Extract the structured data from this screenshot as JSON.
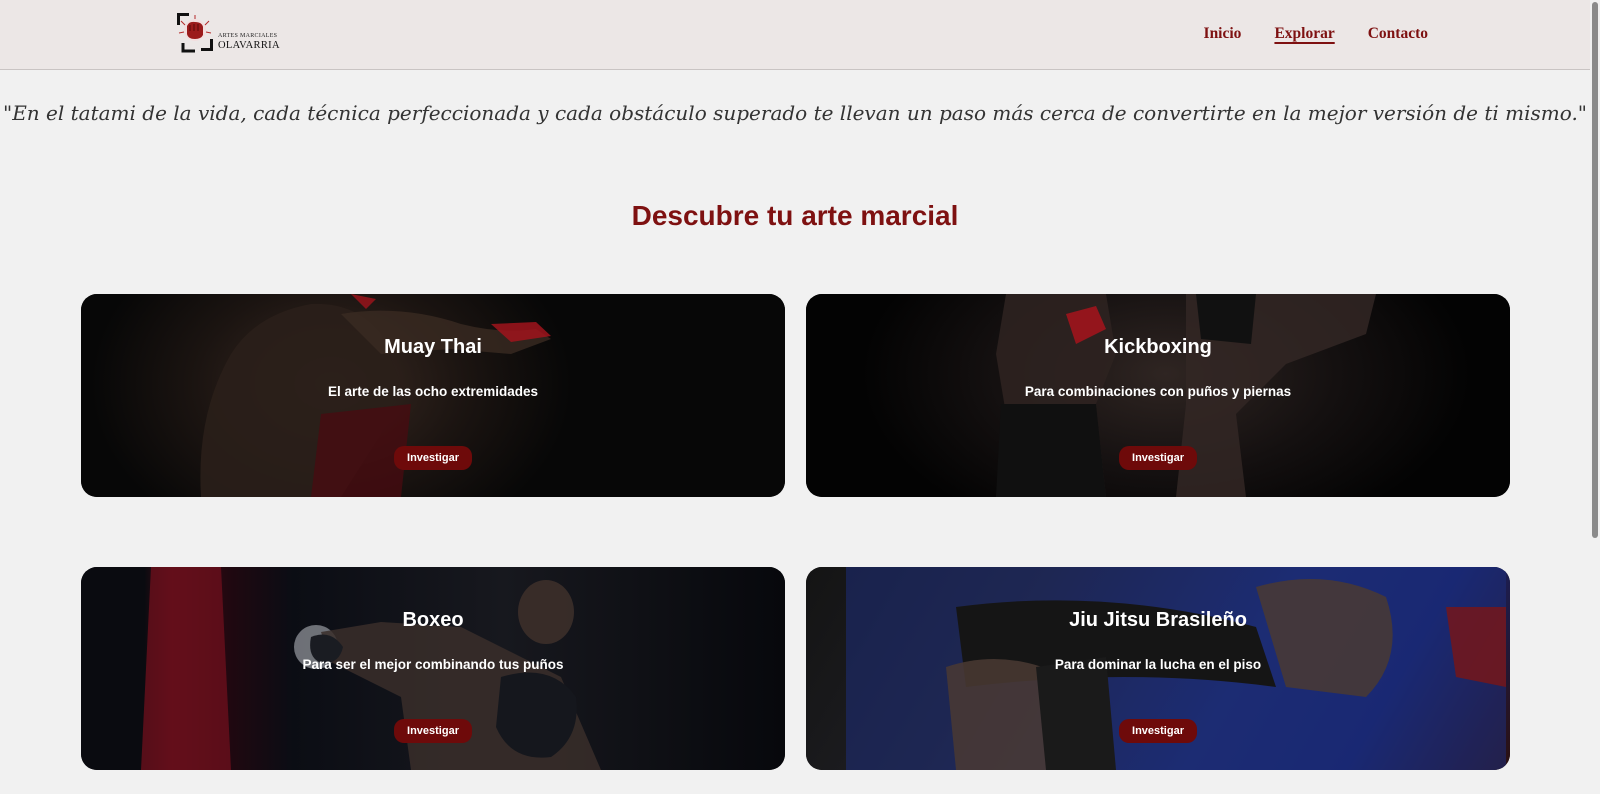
{
  "brand": {
    "small_line": "ARTES MARCIALES",
    "name": "OLAVARRIA"
  },
  "nav": {
    "items": [
      {
        "label": "Inicio",
        "active": false
      },
      {
        "label": "Explorar",
        "active": true
      },
      {
        "label": "Contacto",
        "active": false
      }
    ]
  },
  "quote": "\"En el tatami de la vida, cada técnica perfeccionada y cada obstáculo superado te llevan un paso más cerca de convertirte en la mejor versión de ti mismo.\"",
  "section_title": "Descubre tu arte marcial",
  "cards": [
    {
      "title": "Muay Thai",
      "description": "El arte de las ocho extremidades",
      "button": "Investigar"
    },
    {
      "title": "Kickboxing",
      "description": "Para combinaciones con puños y piernas",
      "button": "Investigar"
    },
    {
      "title": "Boxeo",
      "description": "Para ser el mejor combinando tus puños",
      "button": "Investigar"
    },
    {
      "title": "Jiu Jitsu Brasileño",
      "description": "Para dominar la lucha en el piso",
      "button": "Investigar"
    }
  ],
  "colors": {
    "accent": "#7e1111",
    "button": "#6e0a0a",
    "navbar_bg": "#ece7e6",
    "page_bg": "#f1f1f1"
  },
  "icons": {
    "logo": "fist-logo-icon"
  }
}
